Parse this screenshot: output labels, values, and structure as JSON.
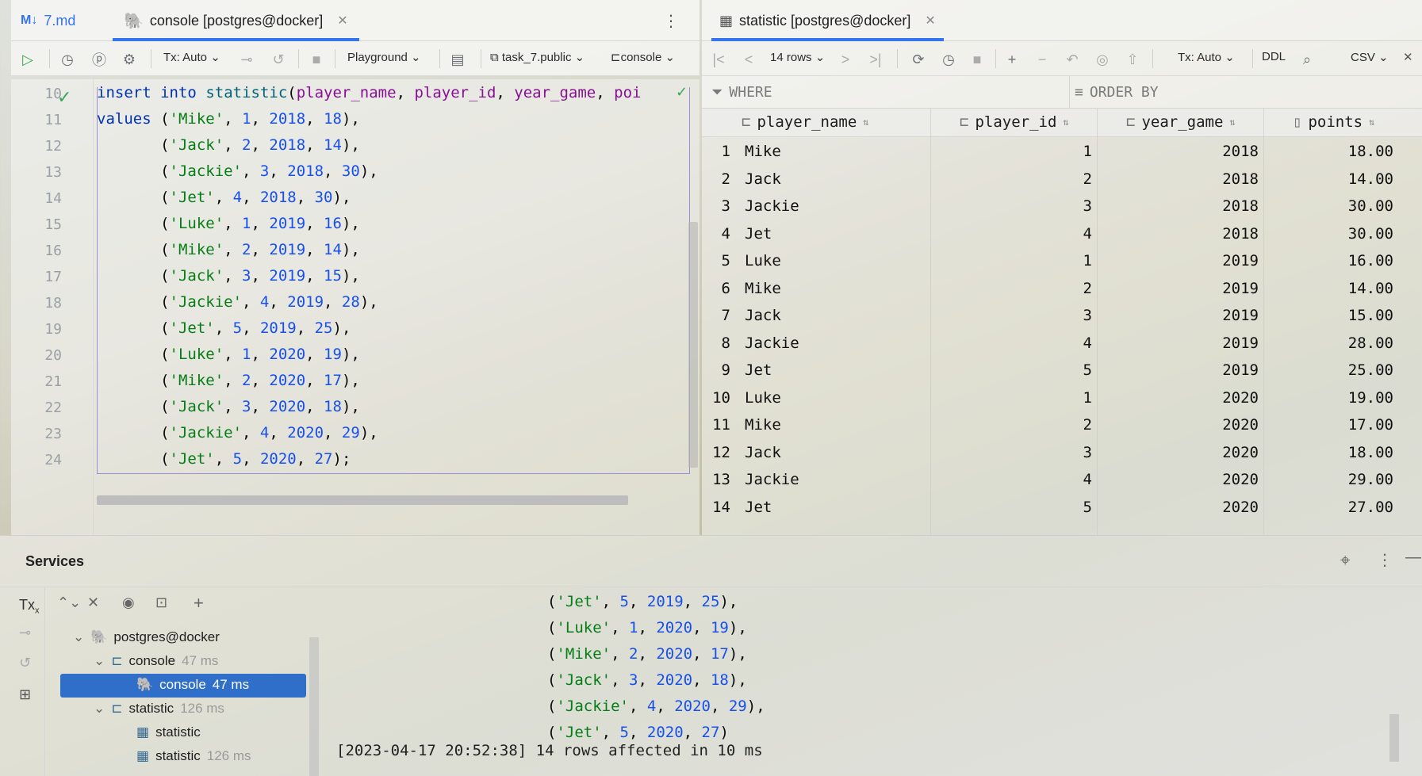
{
  "left_tabs": [
    {
      "label": "7.md",
      "icon": "markdown-icon"
    },
    {
      "label": "console [postgres@docker]",
      "icon": "postgres-icon",
      "active": true
    }
  ],
  "right_tabs": [
    {
      "label": "statistic [postgres@docker]",
      "icon": "table-icon",
      "active": true
    }
  ],
  "editor_toolbar": {
    "tx": "Tx: Auto",
    "playground": "Playground",
    "schema": "task_7.public",
    "session": "console"
  },
  "editor": {
    "lines": [
      {
        "n": "10",
        "tokens": [
          [
            "kw",
            "insert"
          ],
          [
            "t",
            " "
          ],
          [
            "kw",
            "into"
          ],
          [
            "t",
            " "
          ],
          [
            "fn",
            "statistic"
          ],
          [
            "t",
            "("
          ],
          [
            "col",
            "player_name"
          ],
          [
            "t",
            ", "
          ],
          [
            "col",
            "player_id"
          ],
          [
            "t",
            ", "
          ],
          [
            "col",
            "year_game"
          ],
          [
            "t",
            ", "
          ],
          [
            "col",
            "poi"
          ]
        ]
      },
      {
        "n": "11",
        "tokens": [
          [
            "kw",
            "values"
          ],
          [
            "t",
            " ("
          ],
          [
            "str",
            "'Mike'"
          ],
          [
            "t",
            ", "
          ],
          [
            "num",
            "1"
          ],
          [
            "t",
            ", "
          ],
          [
            "num",
            "2018"
          ],
          [
            "t",
            ", "
          ],
          [
            "num",
            "18"
          ],
          [
            "t",
            "),"
          ]
        ]
      },
      {
        "n": "12",
        "tokens": [
          [
            "t",
            "       ("
          ],
          [
            "str",
            "'Jack'"
          ],
          [
            "t",
            ", "
          ],
          [
            "num",
            "2"
          ],
          [
            "t",
            ", "
          ],
          [
            "num",
            "2018"
          ],
          [
            "t",
            ", "
          ],
          [
            "num",
            "14"
          ],
          [
            "t",
            "),"
          ]
        ]
      },
      {
        "n": "13",
        "tokens": [
          [
            "t",
            "       ("
          ],
          [
            "str",
            "'Jackie'"
          ],
          [
            "t",
            ", "
          ],
          [
            "num",
            "3"
          ],
          [
            "t",
            ", "
          ],
          [
            "num",
            "2018"
          ],
          [
            "t",
            ", "
          ],
          [
            "num",
            "30"
          ],
          [
            "t",
            "),"
          ]
        ]
      },
      {
        "n": "14",
        "tokens": [
          [
            "t",
            "       ("
          ],
          [
            "str",
            "'Jet'"
          ],
          [
            "t",
            ", "
          ],
          [
            "num",
            "4"
          ],
          [
            "t",
            ", "
          ],
          [
            "num",
            "2018"
          ],
          [
            "t",
            ", "
          ],
          [
            "num",
            "30"
          ],
          [
            "t",
            "),"
          ]
        ]
      },
      {
        "n": "15",
        "tokens": [
          [
            "t",
            "       ("
          ],
          [
            "str",
            "'Luke'"
          ],
          [
            "t",
            ", "
          ],
          [
            "num",
            "1"
          ],
          [
            "t",
            ", "
          ],
          [
            "num",
            "2019"
          ],
          [
            "t",
            ", "
          ],
          [
            "num",
            "16"
          ],
          [
            "t",
            "),"
          ]
        ]
      },
      {
        "n": "16",
        "tokens": [
          [
            "t",
            "       ("
          ],
          [
            "str",
            "'Mike'"
          ],
          [
            "t",
            ", "
          ],
          [
            "num",
            "2"
          ],
          [
            "t",
            ", "
          ],
          [
            "num",
            "2019"
          ],
          [
            "t",
            ", "
          ],
          [
            "num",
            "14"
          ],
          [
            "t",
            "),"
          ]
        ]
      },
      {
        "n": "17",
        "tokens": [
          [
            "t",
            "       ("
          ],
          [
            "str",
            "'Jack'"
          ],
          [
            "t",
            ", "
          ],
          [
            "num",
            "3"
          ],
          [
            "t",
            ", "
          ],
          [
            "num",
            "2019"
          ],
          [
            "t",
            ", "
          ],
          [
            "num",
            "15"
          ],
          [
            "t",
            "),"
          ]
        ]
      },
      {
        "n": "18",
        "tokens": [
          [
            "t",
            "       ("
          ],
          [
            "str",
            "'Jackie'"
          ],
          [
            "t",
            ", "
          ],
          [
            "num",
            "4"
          ],
          [
            "t",
            ", "
          ],
          [
            "num",
            "2019"
          ],
          [
            "t",
            ", "
          ],
          [
            "num",
            "28"
          ],
          [
            "t",
            "),"
          ]
        ]
      },
      {
        "n": "19",
        "tokens": [
          [
            "t",
            "       ("
          ],
          [
            "str",
            "'Jet'"
          ],
          [
            "t",
            ", "
          ],
          [
            "num",
            "5"
          ],
          [
            "t",
            ", "
          ],
          [
            "num",
            "2019"
          ],
          [
            "t",
            ", "
          ],
          [
            "num",
            "25"
          ],
          [
            "t",
            "),"
          ]
        ]
      },
      {
        "n": "20",
        "tokens": [
          [
            "t",
            "       ("
          ],
          [
            "str",
            "'Luke'"
          ],
          [
            "t",
            ", "
          ],
          [
            "num",
            "1"
          ],
          [
            "t",
            ", "
          ],
          [
            "num",
            "2020"
          ],
          [
            "t",
            ", "
          ],
          [
            "num",
            "19"
          ],
          [
            "t",
            "),"
          ]
        ]
      },
      {
        "n": "21",
        "tokens": [
          [
            "t",
            "       ("
          ],
          [
            "str",
            "'Mike'"
          ],
          [
            "t",
            ", "
          ],
          [
            "num",
            "2"
          ],
          [
            "t",
            ", "
          ],
          [
            "num",
            "2020"
          ],
          [
            "t",
            ", "
          ],
          [
            "num",
            "17"
          ],
          [
            "t",
            "),"
          ]
        ]
      },
      {
        "n": "22",
        "tokens": [
          [
            "t",
            "       ("
          ],
          [
            "str",
            "'Jack'"
          ],
          [
            "t",
            ", "
          ],
          [
            "num",
            "3"
          ],
          [
            "t",
            ", "
          ],
          [
            "num",
            "2020"
          ],
          [
            "t",
            ", "
          ],
          [
            "num",
            "18"
          ],
          [
            "t",
            "),"
          ]
        ]
      },
      {
        "n": "23",
        "tokens": [
          [
            "t",
            "       ("
          ],
          [
            "str",
            "'Jackie'"
          ],
          [
            "t",
            ", "
          ],
          [
            "num",
            "4"
          ],
          [
            "t",
            ", "
          ],
          [
            "num",
            "2020"
          ],
          [
            "t",
            ", "
          ],
          [
            "num",
            "29"
          ],
          [
            "t",
            "),"
          ]
        ]
      },
      {
        "n": "24",
        "tokens": [
          [
            "t",
            "       ("
          ],
          [
            "str",
            "'Jet'"
          ],
          [
            "t",
            ", "
          ],
          [
            "num",
            "5"
          ],
          [
            "t",
            ", "
          ],
          [
            "num",
            "2020"
          ],
          [
            "t",
            ", "
          ],
          [
            "num",
            "27"
          ],
          [
            "t",
            ");"
          ]
        ]
      }
    ]
  },
  "grid_toolbar": {
    "rows": "14 rows",
    "tx": "Tx: Auto",
    "ddl": "DDL",
    "export": "CSV"
  },
  "filter": {
    "where": "WHERE",
    "order_by": "ORDER BY"
  },
  "grid": {
    "columns": [
      "player_name",
      "player_id",
      "year_game",
      "points"
    ],
    "rows": [
      [
        "1",
        "Mike",
        "1",
        "2018",
        "18.00"
      ],
      [
        "2",
        "Jack",
        "2",
        "2018",
        "14.00"
      ],
      [
        "3",
        "Jackie",
        "3",
        "2018",
        "30.00"
      ],
      [
        "4",
        "Jet",
        "4",
        "2018",
        "30.00"
      ],
      [
        "5",
        "Luke",
        "1",
        "2019",
        "16.00"
      ],
      [
        "6",
        "Mike",
        "2",
        "2019",
        "14.00"
      ],
      [
        "7",
        "Jack",
        "3",
        "2019",
        "15.00"
      ],
      [
        "8",
        "Jackie",
        "4",
        "2019",
        "28.00"
      ],
      [
        "9",
        "Jet",
        "5",
        "2019",
        "25.00"
      ],
      [
        "10",
        "Luke",
        "1",
        "2020",
        "19.00"
      ],
      [
        "11",
        "Mike",
        "2",
        "2020",
        "17.00"
      ],
      [
        "12",
        "Jack",
        "3",
        "2020",
        "18.00"
      ],
      [
        "13",
        "Jackie",
        "4",
        "2020",
        "29.00"
      ],
      [
        "14",
        "Jet",
        "5",
        "2020",
        "27.00"
      ]
    ]
  },
  "services": {
    "title": "Services",
    "tx_label": "Tx",
    "tree": [
      {
        "label": "postgres@docker",
        "extra": ""
      },
      {
        "label": "console",
        "extra": "47 ms"
      },
      {
        "label": "console",
        "extra": "47 ms",
        "selected": true
      },
      {
        "label": "statistic",
        "extra": "126 ms"
      },
      {
        "label": "statistic",
        "extra": ""
      },
      {
        "label": "statistic",
        "extra": "126 ms"
      }
    ],
    "output": [
      {
        "tokens": [
          [
            "t",
            "("
          ],
          [
            "str",
            "'Jet'"
          ],
          [
            "t",
            ", "
          ],
          [
            "num",
            "5"
          ],
          [
            "t",
            ", "
          ],
          [
            "num",
            "2019"
          ],
          [
            "t",
            ", "
          ],
          [
            "num",
            "25"
          ],
          [
            "t",
            "),"
          ]
        ]
      },
      {
        "tokens": [
          [
            "t",
            "("
          ],
          [
            "str",
            "'Luke'"
          ],
          [
            "t",
            ", "
          ],
          [
            "num",
            "1"
          ],
          [
            "t",
            ", "
          ],
          [
            "num",
            "2020"
          ],
          [
            "t",
            ", "
          ],
          [
            "num",
            "19"
          ],
          [
            "t",
            "),"
          ]
        ]
      },
      {
        "tokens": [
          [
            "t",
            "("
          ],
          [
            "str",
            "'Mike'"
          ],
          [
            "t",
            ", "
          ],
          [
            "num",
            "2"
          ],
          [
            "t",
            ", "
          ],
          [
            "num",
            "2020"
          ],
          [
            "t",
            ", "
          ],
          [
            "num",
            "17"
          ],
          [
            "t",
            "),"
          ]
        ]
      },
      {
        "tokens": [
          [
            "t",
            "("
          ],
          [
            "str",
            "'Jack'"
          ],
          [
            "t",
            ", "
          ],
          [
            "num",
            "3"
          ],
          [
            "t",
            ", "
          ],
          [
            "num",
            "2020"
          ],
          [
            "t",
            ", "
          ],
          [
            "num",
            "18"
          ],
          [
            "t",
            "),"
          ]
        ]
      },
      {
        "tokens": [
          [
            "t",
            "("
          ],
          [
            "str",
            "'Jackie'"
          ],
          [
            "t",
            ", "
          ],
          [
            "num",
            "4"
          ],
          [
            "t",
            ", "
          ],
          [
            "num",
            "2020"
          ],
          [
            "t",
            ", "
          ],
          [
            "num",
            "29"
          ],
          [
            "t",
            "),"
          ]
        ]
      },
      {
        "tokens": [
          [
            "t",
            "("
          ],
          [
            "str",
            "'Jet'"
          ],
          [
            "t",
            ", "
          ],
          [
            "num",
            "5"
          ],
          [
            "t",
            ", "
          ],
          [
            "num",
            "2020"
          ],
          [
            "t",
            ", "
          ],
          [
            "num",
            "27"
          ],
          [
            "t",
            ")"
          ]
        ]
      }
    ],
    "status_line": "[2023-04-17 20:52:38] 14 rows affected in 10 ms"
  }
}
